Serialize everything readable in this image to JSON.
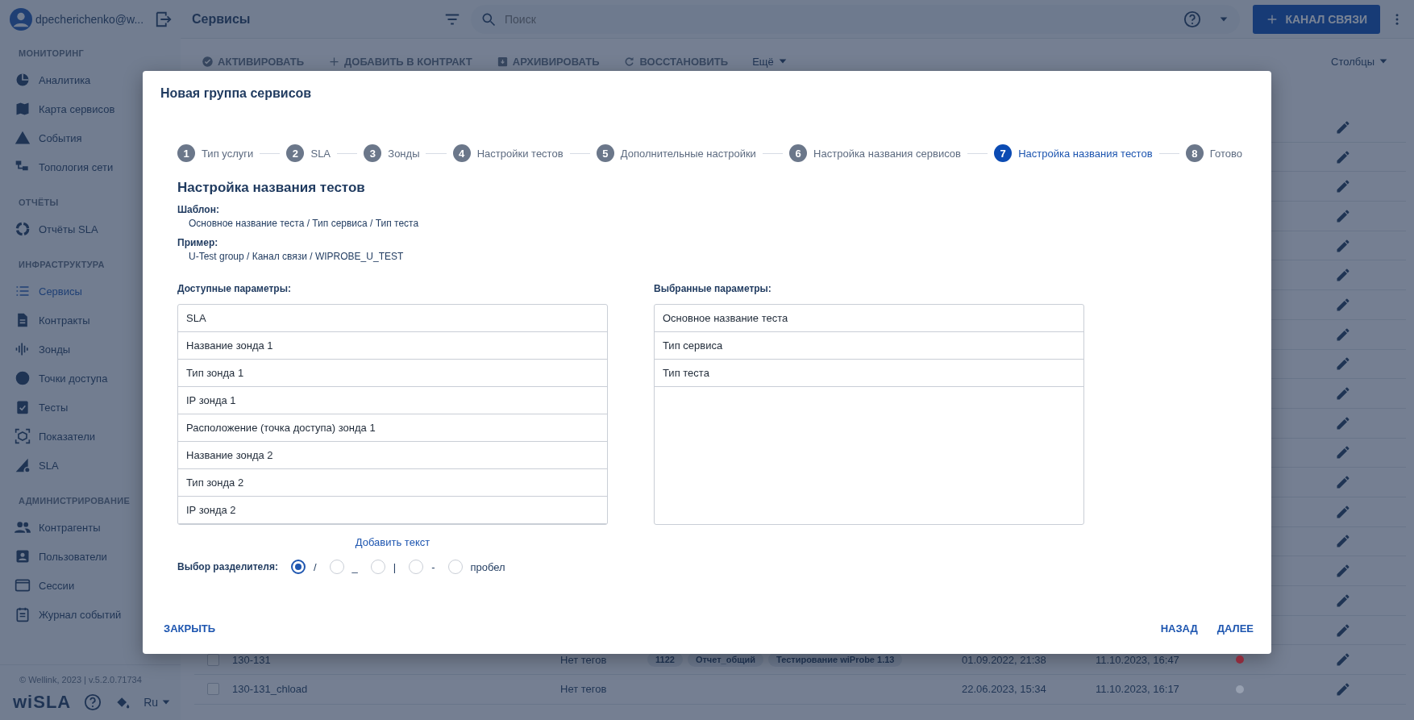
{
  "user": {
    "email": "dpecherichenko@w..."
  },
  "sidebar": {
    "sections": [
      {
        "title": "МОНИТОРИНГ",
        "items": [
          {
            "label": "Аналитика",
            "kind": "pie",
            "selected": false
          },
          {
            "label": "Карта сервисов",
            "kind": "map",
            "selected": false
          },
          {
            "label": "События",
            "kind": "warning",
            "selected": false
          },
          {
            "label": "Топология сети",
            "kind": "tree",
            "selected": false
          }
        ]
      },
      {
        "title": "ОТЧЁТЫ",
        "items": [
          {
            "label": "Отчёты SLA",
            "kind": "ring",
            "selected": false
          }
        ]
      },
      {
        "title": "ИНФРАСТРУКТУРА",
        "items": [
          {
            "label": "Сервисы",
            "kind": "list",
            "selected": true
          },
          {
            "label": "Контракты",
            "kind": "doc",
            "selected": false
          },
          {
            "label": "Зонды",
            "kind": "wave",
            "selected": false
          },
          {
            "label": "Точки доступа",
            "kind": "dot",
            "selected": false
          },
          {
            "label": "Тесты",
            "kind": "clipboard",
            "selected": false
          },
          {
            "label": "Показатели",
            "kind": "cube",
            "selected": false
          },
          {
            "label": "SLA",
            "kind": "sla",
            "selected": false
          }
        ]
      },
      {
        "title": "АДМИНИСТРИРОВАНИЕ",
        "items": [
          {
            "label": "Контрагенты",
            "kind": "people",
            "selected": false
          },
          {
            "label": "Пользователи",
            "kind": "badge",
            "selected": false
          },
          {
            "label": "Сессии",
            "kind": "window",
            "selected": false
          },
          {
            "label": "Журнал событий",
            "kind": "journal",
            "selected": false
          }
        ]
      }
    ],
    "copyright": "© Wellink, 2023 | v.5.2.0.71734",
    "logo": "wiSLA",
    "language": "Ru"
  },
  "header": {
    "title": "Сервисы",
    "search": {
      "placeholder": "Поиск"
    },
    "primary_button": "КАНАЛ СВЯЗИ"
  },
  "toolbar": {
    "actions": [
      {
        "label": "АКТИВИРОВАТЬ",
        "kind": "check"
      },
      {
        "label": "ДОБАВИТЬ В КОНТРАКТ",
        "kind": "plus"
      },
      {
        "label": "АРХИВИРОВАТЬ",
        "kind": "archive"
      },
      {
        "label": "ВОССТАНОВИТЬ",
        "kind": "restore"
      }
    ],
    "more": "Ещё",
    "columns": "Столбцы"
  },
  "table": {
    "rows": [
      {
        "kind": "covered"
      },
      {
        "kind": "covered"
      },
      {
        "kind": "covered"
      },
      {
        "kind": "covered"
      },
      {
        "kind": "covered"
      },
      {
        "kind": "covered"
      },
      {
        "kind": "covered"
      },
      {
        "kind": "covered"
      },
      {
        "kind": "covered"
      },
      {
        "kind": "covered"
      },
      {
        "kind": "covered"
      },
      {
        "kind": "covered"
      },
      {
        "kind": "covered"
      },
      {
        "kind": "covered"
      },
      {
        "kind": "covered"
      },
      {
        "kind": "covered"
      },
      {
        "kind": "covered"
      },
      {
        "kind": "covered"
      },
      {
        "kind": "full",
        "checked": false,
        "name": "130-131",
        "tags_label": "Нет тегов",
        "tags": [
          "1122",
          "Отчет_общий",
          "Тестирование wiProbe 1.13"
        ],
        "created": "01.09.2022, 21:38",
        "updated": "11.10.2023, 16:47",
        "color": "#8e2b3c"
      },
      {
        "kind": "full",
        "checked": false,
        "name": "130-131_chload",
        "tags_label": "Нет тегов",
        "created": "22.06.2023, 15:34",
        "updated": "11.10.2023, 16:17",
        "color": "#97a0b0"
      }
    ]
  },
  "dialog": {
    "title": "Новая группа сервисов",
    "steps": [
      {
        "number": "1",
        "label": "Тип услуги",
        "selected": false
      },
      {
        "number": "2",
        "label": "SLA",
        "selected": false
      },
      {
        "number": "3",
        "label": "Зонды",
        "selected": false
      },
      {
        "number": "4",
        "label": "Настройки тестов",
        "selected": false
      },
      {
        "number": "5",
        "label": "Дополнительные настройки",
        "selected": false
      },
      {
        "number": "6",
        "label": "Настройка названия сервисов",
        "selected": false
      },
      {
        "number": "7",
        "label": "Настройка названия тестов",
        "selected": true
      },
      {
        "number": "8",
        "label": "Готово",
        "selected": false
      }
    ],
    "heading": "Настройка названия тестов",
    "template_label": "Шаблон:",
    "template": "Основное название теста / Тип сервиса / Тип теста",
    "example_label": "Пример:",
    "example": "U-Test group / Канал связи / WIPROBE_U_TEST",
    "available_label": "Доступные параметры:",
    "available": [
      "SLA",
      "Название зонда 1",
      "Тип зонда 1",
      "IP зонда 1",
      "Расположение (точка доступа) зонда 1",
      "Название зонда 2",
      "Тип зонда 2",
      "IP зонда 2"
    ],
    "selected_label": "Выбранные параметры:",
    "chosen": [
      "Основное название теста",
      "Тип сервиса",
      "Тип теста"
    ],
    "add_text": "Добавить текст",
    "separator_label": "Выбор разделителя:",
    "separators": [
      {
        "label": "/",
        "selected": true
      },
      {
        "label": "_",
        "selected": false
      },
      {
        "label": "|",
        "selected": false
      },
      {
        "label": "-",
        "selected": false
      },
      {
        "label": "пробел",
        "selected": false
      }
    ],
    "close": "ЗАКРЫТЬ",
    "back": "НАЗАД",
    "next": "ДАЛЕЕ"
  }
}
